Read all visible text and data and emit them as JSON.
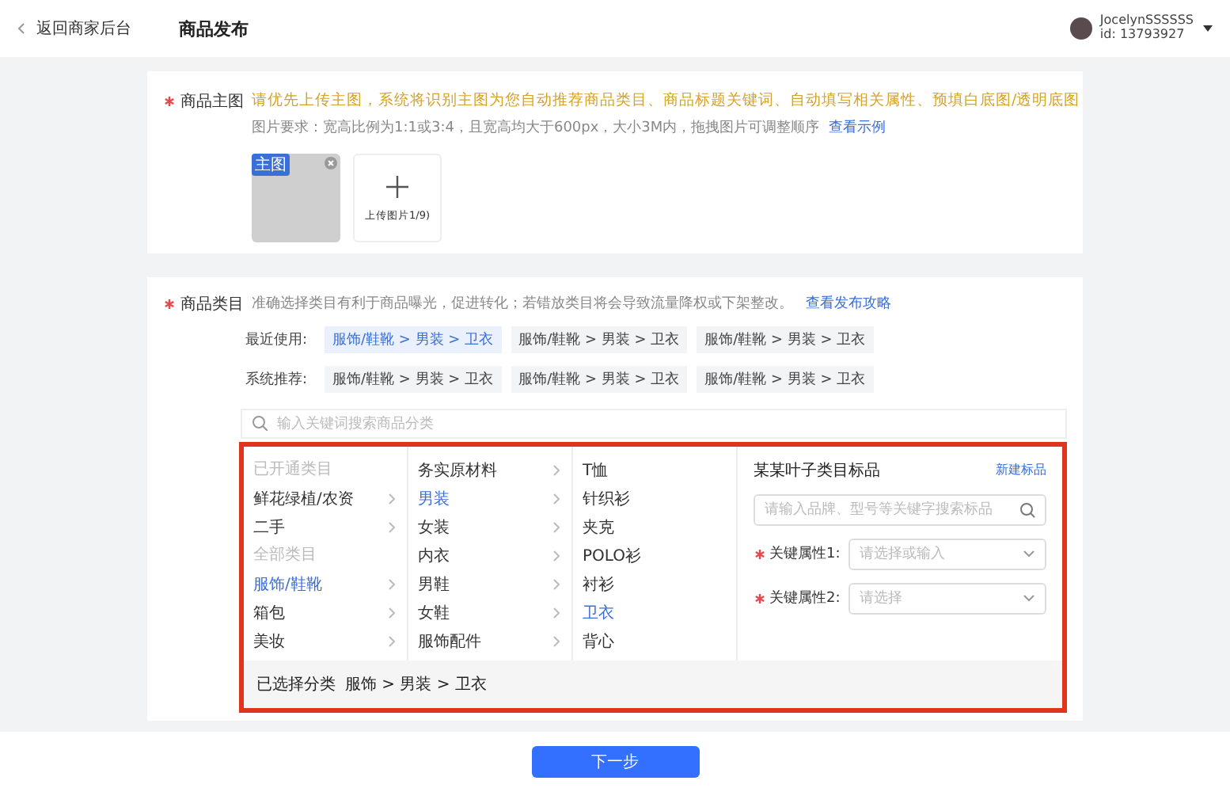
{
  "top_bar": {
    "back_link": "返回商家后台",
    "title": "商品发布",
    "user": {
      "name": "JocelynSSSSSS",
      "id": "id: 13793927"
    }
  },
  "main_image": {
    "label": "商品主图",
    "required": true,
    "hint": "请优先上传主图，系统将识别主图为您自动推荐商品类目、商品标题关键词、自动填写相关属性、预填白底图/透明底图",
    "requirement": "图片要求：宽高比例为1:1或3:4，且宽高均大于600px，大小3M内，拖拽图片可调整顺序",
    "example_link": "查看示例",
    "badge": "主图",
    "upload_label": "上传图片1/9)"
  },
  "category": {
    "label": "商品类目",
    "required": true,
    "hint": "准确选择类目有利于商品曝光，促进转化；若错放类目将会导致流量降权或下架整改。",
    "guide_link": "查看发布攻略",
    "recent": {
      "label": "最近使用:",
      "tags": [
        {
          "text": "服饰/鞋靴 > 男装 > 卫衣",
          "selected": true
        },
        {
          "text": "服饰/鞋靴 > 男装 > 卫衣",
          "selected": false
        },
        {
          "text": "服饰/鞋靴 > 男装 > 卫衣",
          "selected": false
        }
      ]
    },
    "recommended": {
      "label": "系统推荐:",
      "tags": [
        {
          "text": "服饰/鞋靴 > 男装 > 卫衣",
          "selected": false
        },
        {
          "text": "服饰/鞋靴 > 男装 > 卫衣",
          "selected": false
        },
        {
          "text": "服饰/鞋靴 > 男装 > 卫衣",
          "selected": false
        }
      ]
    },
    "search": {
      "placeholder": "输入关键词搜索商品分类"
    },
    "columns": [
      [
        {
          "kind": "header",
          "text": "已开通类目"
        },
        {
          "kind": "item",
          "text": "鲜花绿植/农资",
          "selected": false,
          "has_children": true
        },
        {
          "kind": "item",
          "text": "二手",
          "selected": false,
          "has_children": true
        },
        {
          "kind": "header",
          "text": "全部类目"
        },
        {
          "kind": "item",
          "text": "服饰/鞋靴",
          "selected": true,
          "has_children": true
        },
        {
          "kind": "item",
          "text": "箱包",
          "selected": false,
          "has_children": true
        },
        {
          "kind": "item",
          "text": "美妆",
          "selected": false,
          "has_children": true
        }
      ],
      [
        {
          "kind": "item",
          "text": "务实原材料",
          "selected": false,
          "has_children": true
        },
        {
          "kind": "item",
          "text": "男装",
          "selected": true,
          "has_children": true
        },
        {
          "kind": "item",
          "text": "女装",
          "selected": false,
          "has_children": true
        },
        {
          "kind": "item",
          "text": "内衣",
          "selected": false,
          "has_children": true
        },
        {
          "kind": "item",
          "text": "男鞋",
          "selected": false,
          "has_children": true
        },
        {
          "kind": "item",
          "text": "女鞋",
          "selected": false,
          "has_children": true
        },
        {
          "kind": "item",
          "text": "服饰配件",
          "selected": false,
          "has_children": true
        }
      ],
      [
        {
          "kind": "item",
          "text": "T恤",
          "selected": false,
          "has_children": false
        },
        {
          "kind": "item",
          "text": "针织衫",
          "selected": false,
          "has_children": false
        },
        {
          "kind": "item",
          "text": "夹克",
          "selected": false,
          "has_children": false
        },
        {
          "kind": "item",
          "text": "POLO衫",
          "selected": false,
          "has_children": false
        },
        {
          "kind": "item",
          "text": "衬衫",
          "selected": false,
          "has_children": false
        },
        {
          "kind": "item",
          "text": "卫衣",
          "selected": true,
          "has_children": false
        },
        {
          "kind": "item",
          "text": "背心",
          "selected": false,
          "has_children": false
        }
      ]
    ],
    "standard_product": {
      "title": "某某叶子类目标品",
      "new_link": "新建标品",
      "search": {
        "placeholder": "请输入品牌、型号等关键字搜索标品"
      },
      "attributes": [
        {
          "label": "关键属性1:",
          "required": true,
          "placeholder": "请选择或输入"
        },
        {
          "label": "关键属性2:",
          "required": true,
          "placeholder": "请选择"
        }
      ]
    },
    "selected_path": {
      "label": "已选择分类",
      "path": "服饰 > 男装 > 卫衣"
    }
  },
  "footer": {
    "next_button": "下一步"
  }
}
